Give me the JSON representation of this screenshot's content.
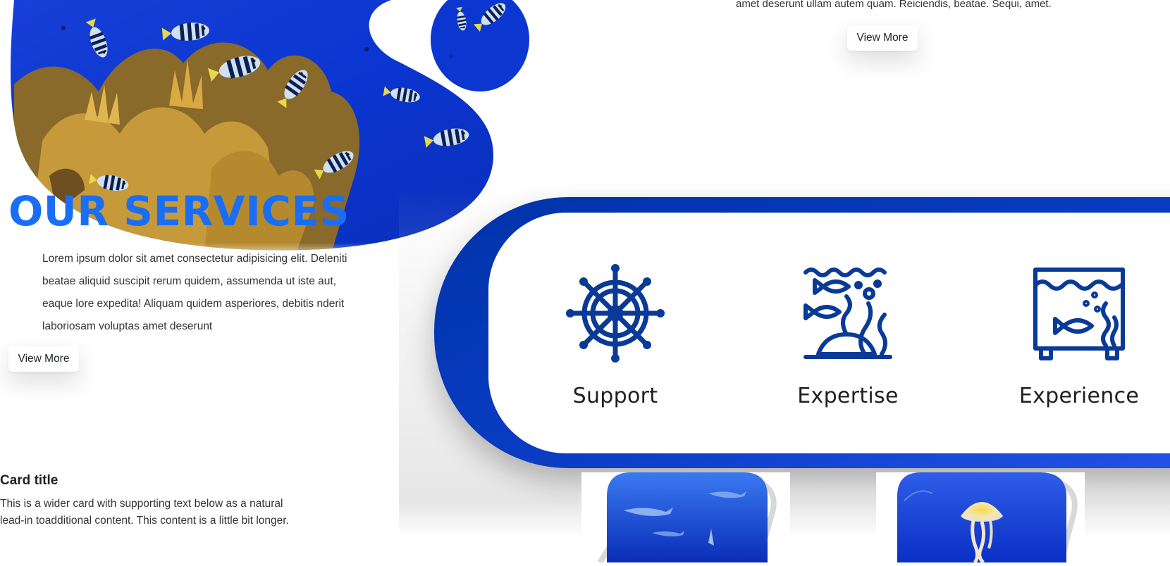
{
  "top_section": {
    "text": "amet deserunt ullam autem quam. Reiciendis, beatae. Sequi, amet.",
    "view_more": "View More"
  },
  "services": {
    "title": "OUR SERVICES",
    "body": "Lorem ipsum dolor sit amet consectetur adipisicing elit. Deleniti beatae aliquid suscipit rerum quidem, assumenda ut iste aut, eaque lore expedita! Aliquam quidem asperiores, debitis nderit laboriosam voluptas amet deserunt",
    "view_more": "View More",
    "items": [
      {
        "label": "Support",
        "icon": "ship-wheel-icon"
      },
      {
        "label": "Expertise",
        "icon": "underwater-fish-icon"
      },
      {
        "label": "Experience",
        "icon": "aquarium-icon"
      }
    ]
  },
  "card": {
    "title": "Card title",
    "text": "This is a wider card with supporting text below as a natural lead-in toadditional content. This content is a little bit longer."
  },
  "gallery": [
    {
      "image": "shark-photo"
    },
    {
      "image": "jellyfish-photo"
    }
  ],
  "colors": {
    "accent_blue": "#1a6ef5",
    "panel_blue": "#0033a8",
    "icon_blue": "#0a3a97",
    "ocean_blue": "#0b3cd6"
  }
}
